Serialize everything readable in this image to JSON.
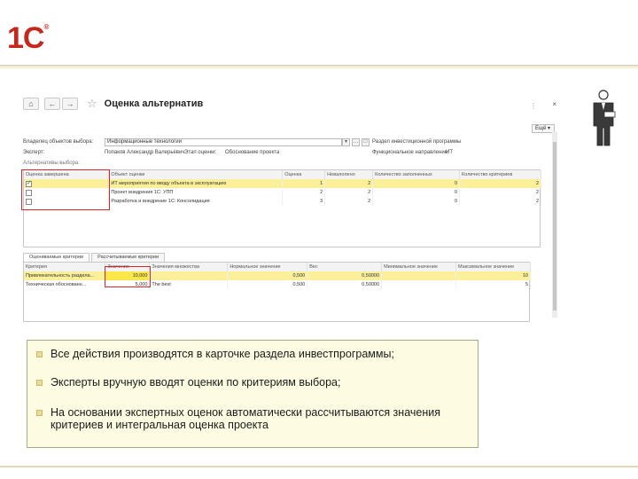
{
  "slide": {
    "logo_text": "1С",
    "logo_reg": "®"
  },
  "window": {
    "title": "Оценка альтернатив",
    "close": "×",
    "more_button": "Ещё ▾",
    "owner_label": "Владелец объектов выбора:",
    "owner_value": "Информационные технологии",
    "section_label": "Раздел инвестиционной программы",
    "expert_label": "Эксперт:",
    "expert_value": "Попаков Александр Валерьевич",
    "stage_label": "Этап оценки:",
    "stage_value": "Обоснование проекта",
    "direction_label": "Функциональное направление:",
    "direction_value": "ИТ",
    "alternatives_label": "Альтернативы выбора:",
    "alt_table": {
      "headers": [
        "Оценка завершена",
        "Объект оценки",
        "Оценка",
        "Невалолено",
        "Количество заполненных",
        "Количество критериев"
      ],
      "rows": [
        {
          "done": true,
          "object": "ИТ мероприятия по вводу объекта в эксплуатацию",
          "score": "1",
          "unfilled": "2",
          "filled": "0",
          "criteria": "2"
        },
        {
          "done": false,
          "object": "Проект внедрения 1С: УПП",
          "score": "2",
          "unfilled": "2",
          "filled": "0",
          "criteria": "2"
        },
        {
          "done": false,
          "object": "Разработка и внедрение 1С: Консолидация",
          "score": "3",
          "unfilled": "2",
          "filled": "0",
          "criteria": "2"
        }
      ]
    },
    "tabs": [
      "Оцениваемые критерии",
      "Рассчитываемые критерии"
    ],
    "crit_table": {
      "headers": [
        "Критерия",
        "Значение",
        "Значения множества",
        "Нормальное значение",
        "Вес",
        "Минимальное значение",
        "Максимальное значение"
      ],
      "rows": [
        {
          "name": "Привлекательность раздела...",
          "value": "10,000",
          "set": "",
          "normal": "0,500",
          "weight": "0,50000",
          "min": "",
          "max": "10"
        },
        {
          "name": "Техническая обоснованн...",
          "value": "5,000",
          "set": "The best",
          "normal": "0,500",
          "weight": "0,50000",
          "min": "",
          "max": "5"
        }
      ]
    }
  },
  "bullets": [
    "Все действия производятся в карточке раздела инвестпрограммы;",
    "Эксперты вручную вводят оценки по критериям выбора;",
    "На основании экспертных оценок автоматически рассчитываются значения критериев и интегральная оценка проекта"
  ]
}
